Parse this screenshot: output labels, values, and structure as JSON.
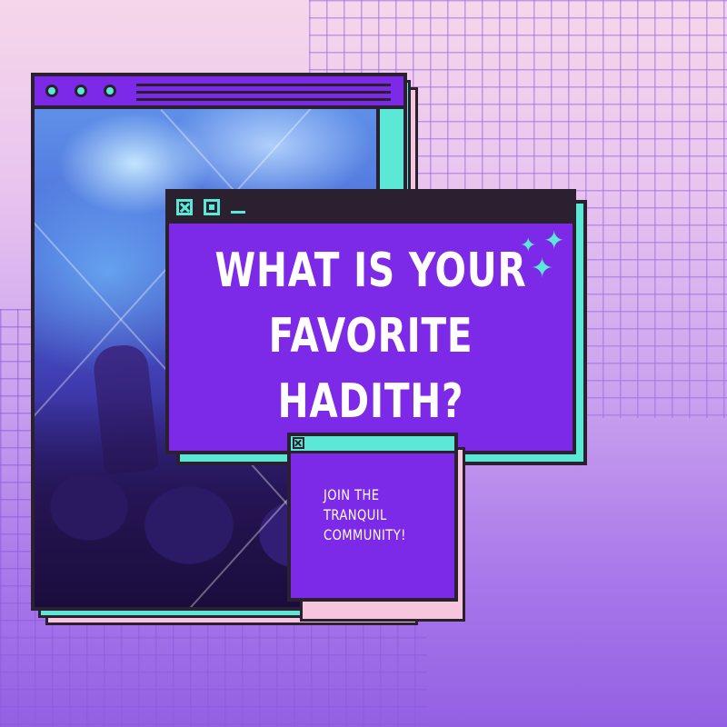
{
  "headline": {
    "line1": "WHAT IS YOUR",
    "line2": "FAVORITE",
    "line3": "HADITH?"
  },
  "cta": {
    "line1": "JOIN THE",
    "line2": "TRANQUIL",
    "line3": "COMMUNITY!"
  },
  "icons": {
    "sparkles": "sparkles-icon",
    "window_close": "close-icon",
    "window_maximize": "maximize-icon",
    "window_minimize": "minimize-icon",
    "window_dots": "traffic-light-dots-icon"
  },
  "colors": {
    "accent_purple": "#7d2ae8",
    "accent_cyan": "#5ce8d6",
    "accent_pink": "#f6c6dc",
    "outline": "#2a2030"
  }
}
